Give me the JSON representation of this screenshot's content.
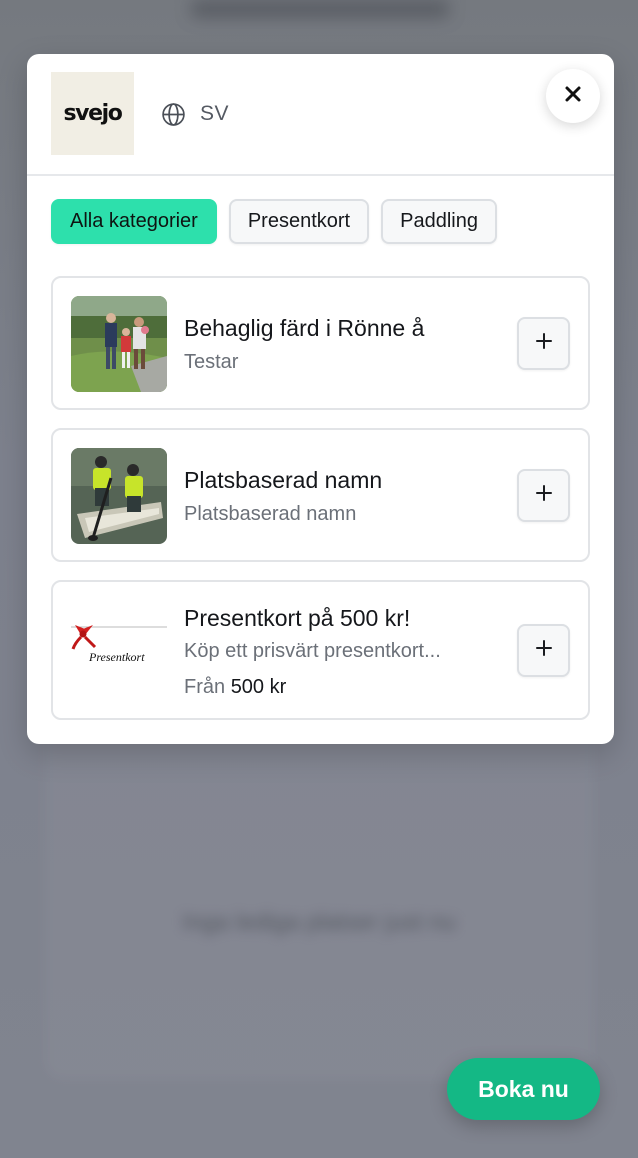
{
  "header": {
    "logo_text": "svejo",
    "language_label": "SV"
  },
  "categories": [
    {
      "label": "Alla kategorier",
      "active": true
    },
    {
      "label": "Presentkort",
      "active": false
    },
    {
      "label": "Paddling",
      "active": false
    }
  ],
  "products": [
    {
      "title": "Behaglig färd i Rönne å",
      "subtitle": "Testar",
      "image": "family-by-lake-photo"
    },
    {
      "title": "Platsbaserad namn",
      "subtitle": "Platsbaserad namn",
      "image": "canoe-paddlers-photo"
    },
    {
      "title": "Presentkort på 500 kr!",
      "subtitle": "Köp ett prisvärt presentkort...",
      "price_prefix": "Från",
      "price_value": "500 kr",
      "image": "gift-card-image",
      "image_text": "Presentkort"
    }
  ],
  "background": {
    "blurred_text": "Inga lediga platser just nu"
  },
  "cta": {
    "book_label": "Boka nu"
  },
  "colors": {
    "accent_chip": "#2de0ac",
    "cta": "#14b885",
    "overlay": "#7b7f8b"
  }
}
